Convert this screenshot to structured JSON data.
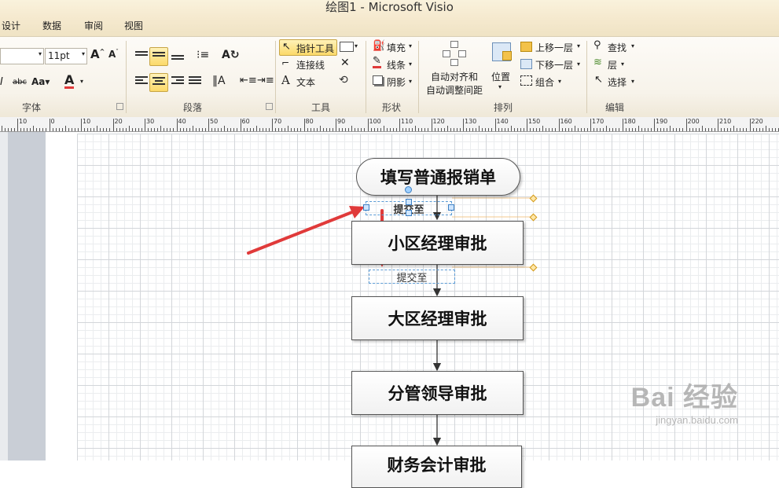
{
  "window": {
    "title": "绘图1 - Microsoft Visio"
  },
  "tabs": [
    "设计",
    "数据",
    "审阅",
    "视图"
  ],
  "ribbon": {
    "font": {
      "label": "字体",
      "font_name": "",
      "font_size": "11pt"
    },
    "paragraph": {
      "label": "段落"
    },
    "tools": {
      "label": "工具",
      "pointer": "指针工具",
      "connector": "连接线",
      "text": "文本"
    },
    "shape": {
      "label": "形状",
      "fill": "填充",
      "line": "线条",
      "shadow": "阴影"
    },
    "arrange": {
      "label": "排列",
      "auto_align": "自动对齐和",
      "auto_space": "自动调整间距",
      "position": "位置",
      "bring_forward": "上移一层",
      "send_backward": "下移一层",
      "group": "组合"
    },
    "editing": {
      "label": "编辑",
      "find": "查找",
      "layers": "层",
      "select": "选择"
    }
  },
  "ruler": {
    "labels": [
      "10",
      "0",
      "10",
      "20",
      "30",
      "40",
      "50",
      "60",
      "70",
      "80",
      "90",
      "100",
      "110",
      "120",
      "130",
      "140",
      "150",
      "160",
      "170",
      "180",
      "190",
      "200",
      "210",
      "220"
    ]
  },
  "diagram": {
    "start": "填写普通报销单",
    "step1": "小区经理审批",
    "step2": "大区经理审批",
    "step3": "分管领导审批",
    "step4": "财务会计审批",
    "conn_label1": "提交至",
    "conn_label2": "提交至"
  },
  "watermark": {
    "brand": "Bai 经验",
    "url": "jingyan.baidu.com"
  },
  "colors": {
    "accent_red": "#e03a3a",
    "selection_blue": "#5b9bd5"
  }
}
